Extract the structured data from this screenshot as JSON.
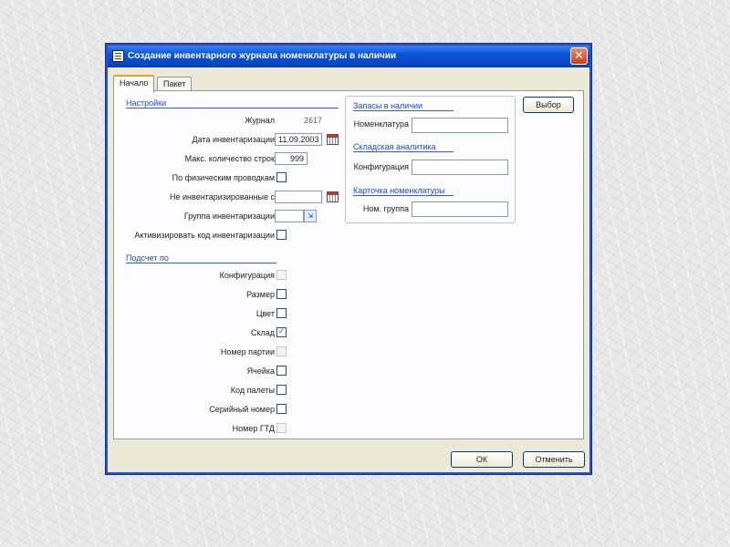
{
  "window": {
    "title": "Создание инвентарного журнала номенклатуры в наличии",
    "close_glyph": "✕"
  },
  "tabs": [
    {
      "label": "Начало",
      "active": true
    },
    {
      "label": "Пакет",
      "active": false
    }
  ],
  "settings": {
    "section_title": "Настройки",
    "journal_label": "Журнал",
    "journal_value": "2617",
    "inventory_date_label": "Дата инвентаризации",
    "inventory_date_value": "11.09.2003",
    "max_rows_label": "Макс. количество строк",
    "max_rows_value": "999",
    "by_physical_label": "По физическим проводкам",
    "not_inventoried_label": "Не инвентаризированные с",
    "not_inventoried_value": "",
    "inventory_group_label": "Группа инвентаризации",
    "inventory_group_value": "",
    "activate_counting_label": "Активизировать код инвентаризации"
  },
  "dimensions": {
    "section_title": "Подсчет по",
    "items": [
      {
        "label": "Конфигурация",
        "checked": false,
        "disabled": true
      },
      {
        "label": "Размер",
        "checked": false,
        "disabled": false
      },
      {
        "label": "Цвет",
        "checked": false,
        "disabled": false
      },
      {
        "label": "Склад",
        "checked": true,
        "disabled": false
      },
      {
        "label": "Номер партии",
        "checked": false,
        "disabled": true
      },
      {
        "label": "Ячейка",
        "checked": false,
        "disabled": false
      },
      {
        "label": "Код палеты",
        "checked": false,
        "disabled": false
      },
      {
        "label": "Серийный номер",
        "checked": false,
        "disabled": false
      },
      {
        "label": "Номер ГТД",
        "checked": false,
        "disabled": true
      }
    ]
  },
  "query": {
    "onhand_title": "Запасы в наличии",
    "item_label": "Номенклатура",
    "item_value": "",
    "stock_dims_title": "Складская аналитика",
    "config_label": "Конфигурация",
    "config_value": "",
    "item_card_title": "Карточка номенклатуры",
    "item_group_label": "Ном. группа",
    "item_group_value": ""
  },
  "buttons": {
    "select": "Выбор",
    "ok": "ОК",
    "cancel": "Отменить"
  }
}
